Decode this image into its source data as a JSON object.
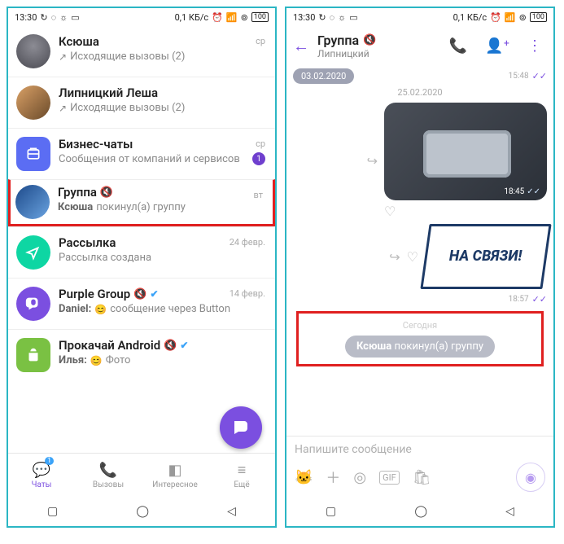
{
  "status": {
    "time": "13:30",
    "net": "0,1 КБ/с",
    "battery": "100"
  },
  "left": {
    "chats": [
      {
        "name": "Ксюша",
        "sub_prefix": "↗",
        "sub": "Исходящие вызовы (2)",
        "meta": "ср"
      },
      {
        "name": "Липницкий Леша",
        "sub_prefix": "↗",
        "sub": "Исходящие вызовы (2)",
        "meta": ""
      },
      {
        "name": "Бизнес-чаты",
        "sub": "Сообщения от компаний и сервисов",
        "meta": "ср",
        "badge": "1"
      },
      {
        "name": "Группа",
        "muted": true,
        "sub_strong": "Ксюша",
        "sub_rest": "покинул(а) группу",
        "meta": "вт"
      },
      {
        "name": "Рассылка",
        "sub": "Рассылка создана",
        "meta": "24 февр."
      },
      {
        "name": "Purple Group",
        "muted": true,
        "verified": true,
        "sub_strong": "Daniel:",
        "sub_prefix": "😊",
        "sub_rest": "сообщение через Button",
        "meta": "14 февр."
      },
      {
        "name": "Прокачай Android",
        "muted": true,
        "verified": true,
        "sub_strong": "Илья:",
        "sub_prefix": "😊",
        "sub_rest": "Фото",
        "meta": ""
      }
    ],
    "nav": {
      "chats": "Чаты",
      "chats_badge": "1",
      "calls": "Вызовы",
      "explore": "Интересное",
      "more": "Ещё"
    }
  },
  "right": {
    "header": {
      "title": "Группа",
      "subtitle": "Липницкий"
    },
    "prev_date": "03.02.2020",
    "prev_time": "15:48",
    "date2": "25.02.2020",
    "img_time": "18:45",
    "sticker_text": "НА СВЯЗИ!",
    "sticker_time": "18:57",
    "today_label": "Сегодня",
    "system_event": {
      "who": "Ксюша",
      "rest": "покинул(а) группу"
    },
    "input_placeholder": "Напишите сообщение"
  }
}
